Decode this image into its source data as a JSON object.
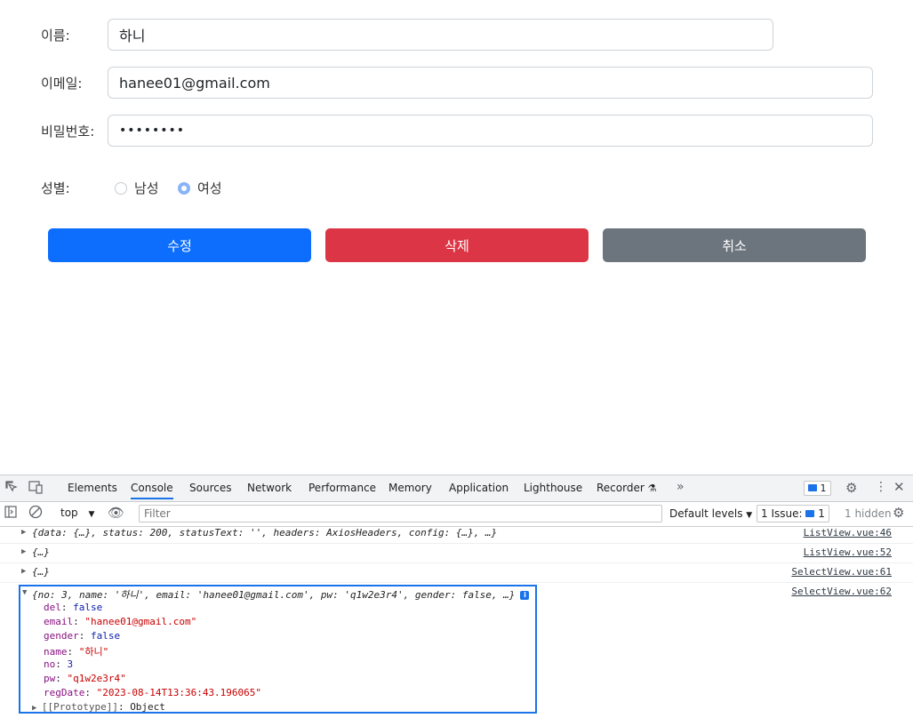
{
  "form": {
    "name_label": "이름:",
    "name_value": "하니",
    "email_label": "이메일:",
    "email_value": "hanee01@gmail.com",
    "pw_label": "비밀번호:",
    "pw_value": "••••••••",
    "gender_label": "성별:",
    "gender_options": [
      "남성",
      "여성"
    ],
    "gender_selected": "여성",
    "buttons": {
      "edit": "수정",
      "delete": "삭제",
      "cancel": "취소"
    },
    "colors": {
      "edit": "#0d6efd",
      "delete": "#dc3545",
      "cancel": "#6c757d"
    }
  },
  "devtools": {
    "tabs": [
      "Elements",
      "Console",
      "Sources",
      "Network",
      "Performance",
      "Memory",
      "Application",
      "Lighthouse",
      "Recorder"
    ],
    "active_tab": "Console",
    "messages_badge": "1",
    "context": "top",
    "filter_placeholder": "Filter",
    "levels": "Default levels",
    "issues_label": "1 Issue:",
    "issues_count": "1",
    "hidden_label": "1 hidden",
    "logs": [
      {
        "text": "{data: {…}, status: 200, statusText: '', headers: AxiosHeaders, config: {…}, …}",
        "source": "ListView.vue:46"
      },
      {
        "text": "{…}",
        "source": "ListView.vue:52"
      },
      {
        "text": "{…}",
        "source": "SelectView.vue:61"
      },
      {
        "text": "{no: 3, name: '하니', email: 'hanee01@gmail.com', pw: 'q1w2e3r4', gender: false, …}",
        "source": "SelectView.vue:62"
      }
    ],
    "expanded": {
      "del_key": "del",
      "del_val": "false",
      "email_key": "email",
      "email_val": "\"hanee01@gmail.com\"",
      "gender_key": "gender",
      "gender_val": "false",
      "name_key": "name",
      "name_val": "\"하니\"",
      "no_key": "no",
      "no_val": "3",
      "pw_key": "pw",
      "pw_val": "\"q1w2e3r4\"",
      "regDate_key": "regDate",
      "regDate_val": "\"2023-08-14T13:36:43.196065\"",
      "proto_key": "[[Prototype]]",
      "proto_val": "Object"
    }
  }
}
